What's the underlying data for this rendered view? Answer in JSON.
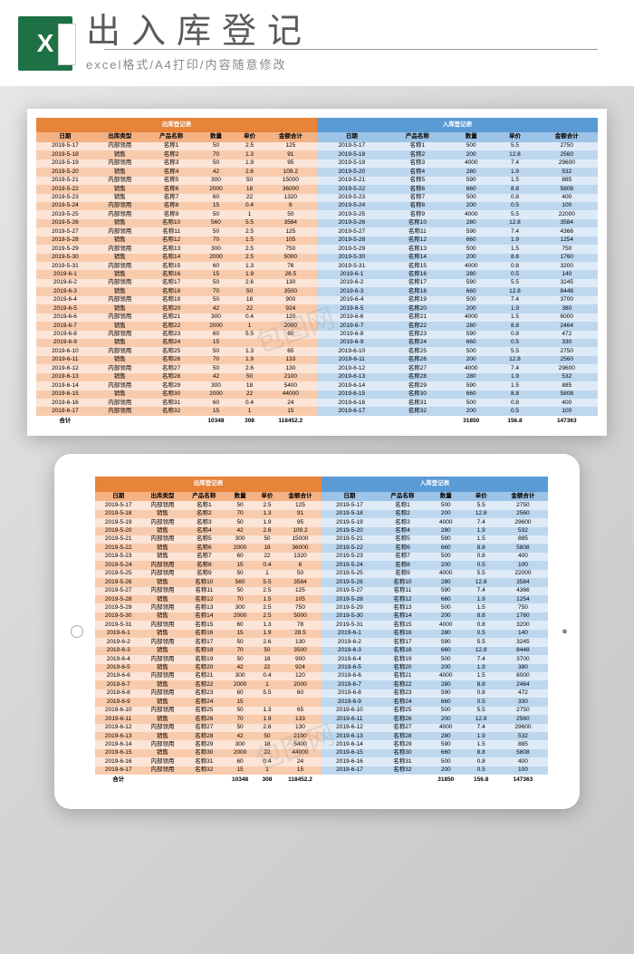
{
  "header": {
    "title": "出入库登记",
    "subtitle": "excel格式/A4打印/内容随意修改"
  },
  "watermark": "包图网",
  "chart_data": {
    "type": "table",
    "outbound": {
      "title": "出库登记表",
      "headers": [
        "日期",
        "出库类型",
        "产品名称",
        "数量",
        "单价",
        "金额合计"
      ],
      "rows": [
        [
          "2019-5-17",
          "内部领用",
          "名称1",
          50,
          2.5,
          125
        ],
        [
          "2019-5-18",
          "销售",
          "名称2",
          70,
          1.3,
          91
        ],
        [
          "2019-5-19",
          "内部领用",
          "名称3",
          50,
          1.9,
          95
        ],
        [
          "2019-5-20",
          "销售",
          "名称4",
          42,
          2.6,
          109.2
        ],
        [
          "2019-5-21",
          "内部领用",
          "名称5",
          300,
          50,
          15000
        ],
        [
          "2019-5-22",
          "销售",
          "名称6",
          2000,
          18,
          36000
        ],
        [
          "2019-5-23",
          "销售",
          "名称7",
          60,
          22,
          1320
        ],
        [
          "2019-5-24",
          "内部领用",
          "名称8",
          15,
          0.4,
          6
        ],
        [
          "2019-5-25",
          "内部领用",
          "名称9",
          50,
          1,
          50
        ],
        [
          "2019-5-26",
          "销售",
          "名称10",
          560,
          5.5,
          3584
        ],
        [
          "2019-5-27",
          "内部领用",
          "名称11",
          50,
          2.5,
          125
        ],
        [
          "2019-5-28",
          "销售",
          "名称12",
          70,
          1.5,
          105
        ],
        [
          "2019-5-29",
          "内部领用",
          "名称13",
          300,
          2.5,
          750
        ],
        [
          "2019-5-30",
          "销售",
          "名称14",
          2000,
          2.5,
          5000
        ],
        [
          "2019-5-31",
          "内部领用",
          "名称15",
          60,
          1.3,
          78
        ],
        [
          "2019-6-1",
          "销售",
          "名称16",
          15,
          1.9,
          28.5
        ],
        [
          "2019-6-2",
          "内部领用",
          "名称17",
          50,
          2.6,
          130
        ],
        [
          "2019-6-3",
          "销售",
          "名称18",
          70,
          50,
          3500
        ],
        [
          "2019-6-4",
          "内部领用",
          "名称19",
          50,
          18,
          900
        ],
        [
          "2019-6-5",
          "销售",
          "名称20",
          42,
          22,
          924
        ],
        [
          "2019-6-6",
          "内部领用",
          "名称21",
          300,
          0.4,
          120
        ],
        [
          "2019-6-7",
          "销售",
          "名称22",
          2000,
          1,
          2000
        ],
        [
          "2019-6-8",
          "内部领用",
          "名称23",
          60,
          5.5,
          60
        ],
        [
          "2019-6-9",
          "销售",
          "名称24",
          15,
          "",
          ""
        ],
        [
          "2019-6-10",
          "内部领用",
          "名称25",
          50,
          1.3,
          65
        ],
        [
          "2019-6-11",
          "销售",
          "名称26",
          70,
          1.9,
          133
        ],
        [
          "2019-6-12",
          "内部领用",
          "名称27",
          50,
          2.6,
          130
        ],
        [
          "2019-6-13",
          "销售",
          "名称28",
          42,
          50,
          2100
        ],
        [
          "2019-6-14",
          "内部领用",
          "名称29",
          300,
          18,
          5400
        ],
        [
          "2019-6-15",
          "销售",
          "名称30",
          2000,
          22,
          44000
        ],
        [
          "2019-6-16",
          "内部领用",
          "名称31",
          60,
          0.4,
          24
        ],
        [
          "2019-6-17",
          "内部领用",
          "名称32",
          15,
          1,
          15
        ]
      ],
      "totals": [
        "合计",
        "",
        "",
        10348,
        308,
        118452.2
      ]
    },
    "inbound": {
      "title": "入库登记表",
      "headers": [
        "日期",
        "产品名称",
        "数量",
        "单价",
        "金额合计"
      ],
      "rows": [
        [
          "2019-5-17",
          "名称1",
          500,
          5.5,
          2750
        ],
        [
          "2019-5-18",
          "名称2",
          200,
          12.8,
          2560
        ],
        [
          "2019-5-19",
          "名称3",
          4000,
          7.4,
          29600
        ],
        [
          "2019-5-20",
          "名称4",
          280,
          1.9,
          532
        ],
        [
          "2019-5-21",
          "名称5",
          590,
          1.5,
          885
        ],
        [
          "2019-5-22",
          "名称6",
          660,
          8.8,
          5808
        ],
        [
          "2019-5-23",
          "名称7",
          500,
          0.8,
          400
        ],
        [
          "2019-5-24",
          "名称8",
          200,
          0.5,
          100
        ],
        [
          "2019-5-25",
          "名称9",
          4000,
          5.5,
          22000
        ],
        [
          "2019-5-26",
          "名称10",
          280,
          12.8,
          3584
        ],
        [
          "2019-5-27",
          "名称11",
          590,
          7.4,
          4366
        ],
        [
          "2019-5-28",
          "名称12",
          660,
          1.9,
          1254
        ],
        [
          "2019-5-29",
          "名称13",
          500,
          1.5,
          750
        ],
        [
          "2019-5-30",
          "名称14",
          200,
          8.8,
          1760
        ],
        [
          "2019-5-31",
          "名称15",
          4000,
          0.8,
          3200
        ],
        [
          "2019-6-1",
          "名称16",
          280,
          0.5,
          140
        ],
        [
          "2019-6-2",
          "名称17",
          590,
          5.5,
          3245
        ],
        [
          "2019-6-3",
          "名称18",
          660,
          12.8,
          8448
        ],
        [
          "2019-6-4",
          "名称19",
          500,
          7.4,
          3700
        ],
        [
          "2019-6-5",
          "名称20",
          200,
          1.9,
          380
        ],
        [
          "2019-6-6",
          "名称21",
          4000,
          1.5,
          6000
        ],
        [
          "2019-6-7",
          "名称22",
          280,
          8.8,
          2464
        ],
        [
          "2019-6-8",
          "名称23",
          590,
          0.8,
          472
        ],
        [
          "2019-6-9",
          "名称24",
          660,
          0.5,
          330
        ],
        [
          "2019-6-10",
          "名称25",
          500,
          5.5,
          2750
        ],
        [
          "2019-6-11",
          "名称26",
          200,
          12.8,
          2560
        ],
        [
          "2019-6-12",
          "名称27",
          4000,
          7.4,
          29600
        ],
        [
          "2019-6-13",
          "名称28",
          280,
          1.9,
          532
        ],
        [
          "2019-6-14",
          "名称29",
          590,
          1.5,
          885
        ],
        [
          "2019-6-15",
          "名称30",
          660,
          8.8,
          5808
        ],
        [
          "2019-6-16",
          "名称31",
          500,
          0.8,
          400
        ],
        [
          "2019-6-17",
          "名称32",
          200,
          0.5,
          100
        ]
      ],
      "totals": [
        "",
        "",
        31850,
        156.8,
        147363
      ]
    }
  }
}
